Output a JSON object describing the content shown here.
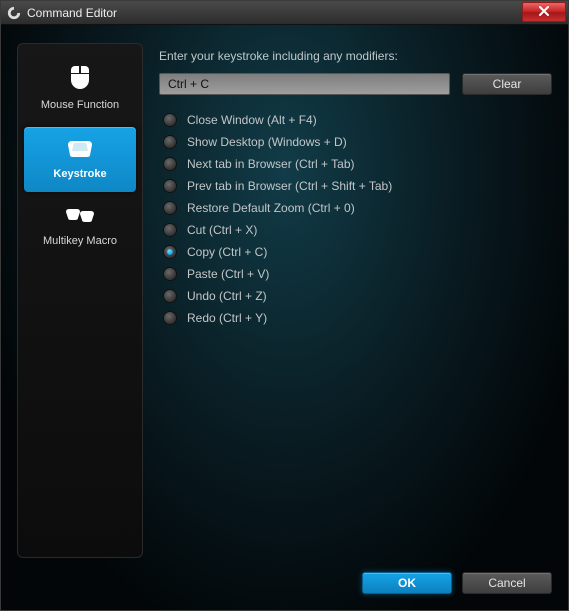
{
  "window": {
    "title": "Command Editor"
  },
  "sidebar": {
    "items": [
      {
        "id": "mouse-function",
        "label": "Mouse Function",
        "active": false,
        "icon": "mouse"
      },
      {
        "id": "keystroke",
        "label": "Keystroke",
        "active": true,
        "icon": "keycap"
      },
      {
        "id": "multikey-macro",
        "label": "Multikey Macro",
        "active": false,
        "icon": "macro"
      }
    ]
  },
  "content": {
    "prompt": "Enter your keystroke including any modifiers:",
    "keystroke_value": "Ctrl + C",
    "clear_label": "Clear",
    "options": [
      {
        "label": "Close Window (Alt + F4)",
        "selected": false
      },
      {
        "label": "Show Desktop (Windows + D)",
        "selected": false
      },
      {
        "label": "Next tab in Browser (Ctrl + Tab)",
        "selected": false
      },
      {
        "label": "Prev tab in Browser (Ctrl + Shift + Tab)",
        "selected": false
      },
      {
        "label": "Restore Default Zoom (Ctrl + 0)",
        "selected": false
      },
      {
        "label": "Cut (Ctrl + X)",
        "selected": false
      },
      {
        "label": "Copy (Ctrl + C)",
        "selected": true
      },
      {
        "label": "Paste (Ctrl + V)",
        "selected": false
      },
      {
        "label": "Undo (Ctrl + Z)",
        "selected": false
      },
      {
        "label": "Redo (Ctrl + Y)",
        "selected": false
      }
    ]
  },
  "footer": {
    "ok_label": "OK",
    "cancel_label": "Cancel"
  }
}
